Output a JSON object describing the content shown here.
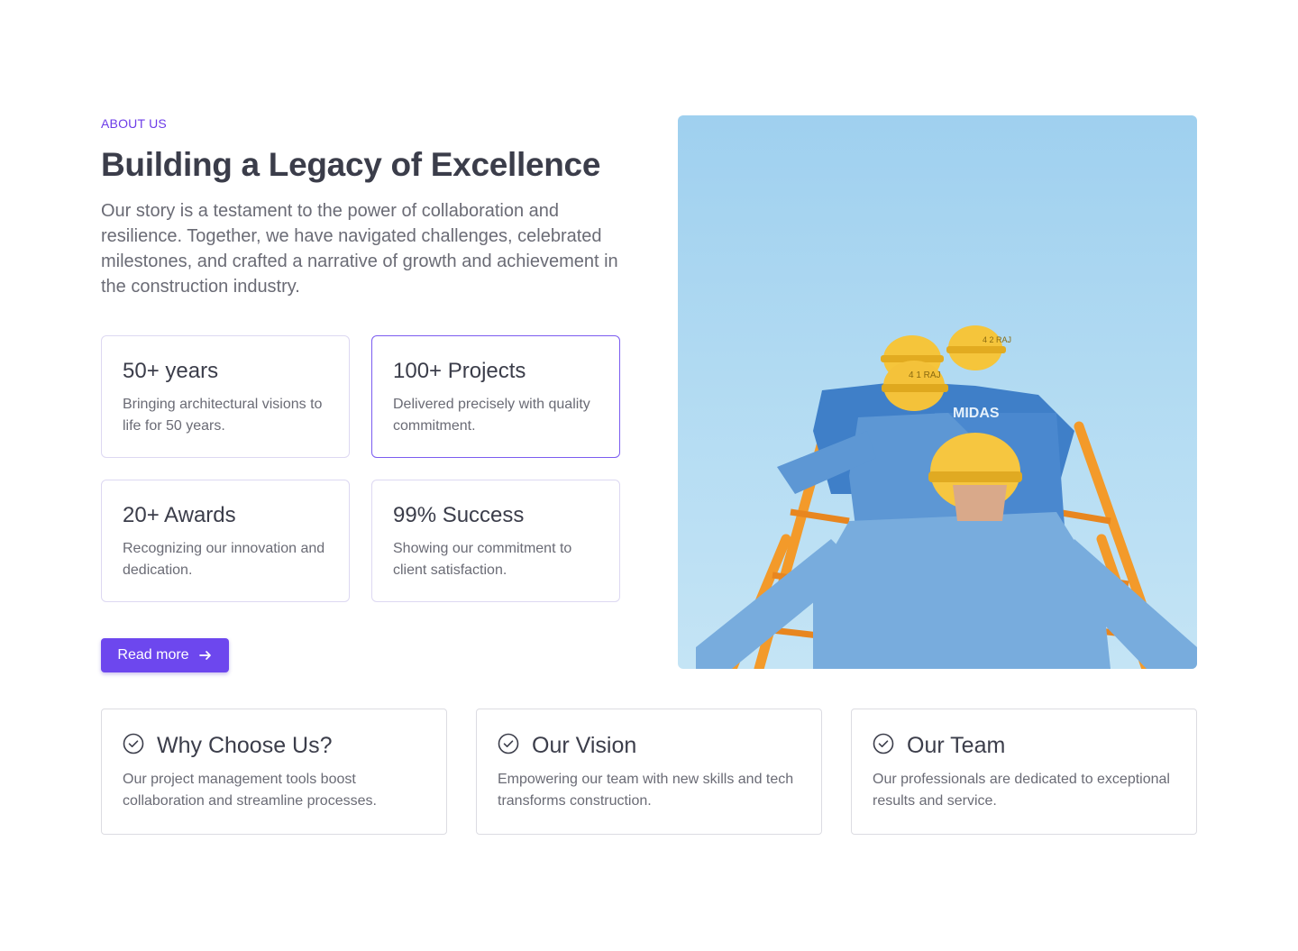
{
  "about": {
    "eyebrow": "ABOUT US",
    "title": "Building a Legacy of Excellence",
    "description": "Our story is a testament to the power of collaboration and resilience. Together, we have navigated challenges, celebrated milestones, and crafted a narrative of growth and achievement in the construction industry."
  },
  "stats": [
    {
      "title": "50+ years",
      "text": "Bringing architectural visions to life for 50 years."
    },
    {
      "title": "100+ Projects",
      "text": "Delivered precisely with quality commitment."
    },
    {
      "title": "20+ Awards",
      "text": "Recognizing our innovation and dedication."
    },
    {
      "title": "99% Success",
      "text": "Showing our commitment to client satisfaction."
    }
  ],
  "cta": {
    "label": "Read more",
    "icon": "arrow-right-icon"
  },
  "photo": {
    "helmet_labels": [
      "4 1 RAJ",
      "4 2 RAJ"
    ],
    "shirt_label": "MIDAS",
    "colors": {
      "sky": "#a8d8f2",
      "helmet": "#f5c53b",
      "uniform": "#6ea3d8",
      "rail": "#f39a2a"
    }
  },
  "features": [
    {
      "icon": "check-circle-icon",
      "title": "Why Choose Us?",
      "text": "Our project management tools boost collaboration and streamline processes."
    },
    {
      "icon": "check-circle-icon",
      "title": "Our Vision",
      "text": "Empowering our team with new skills and tech transforms construction."
    },
    {
      "icon": "check-circle-icon",
      "title": "Our Team",
      "text": "Our professionals are dedicated to exceptional results and service."
    }
  ],
  "colors": {
    "accent": "#6d47ee",
    "heading": "#3b3d4a",
    "body": "#6a6b75",
    "card_border": "#ddd8f2"
  }
}
